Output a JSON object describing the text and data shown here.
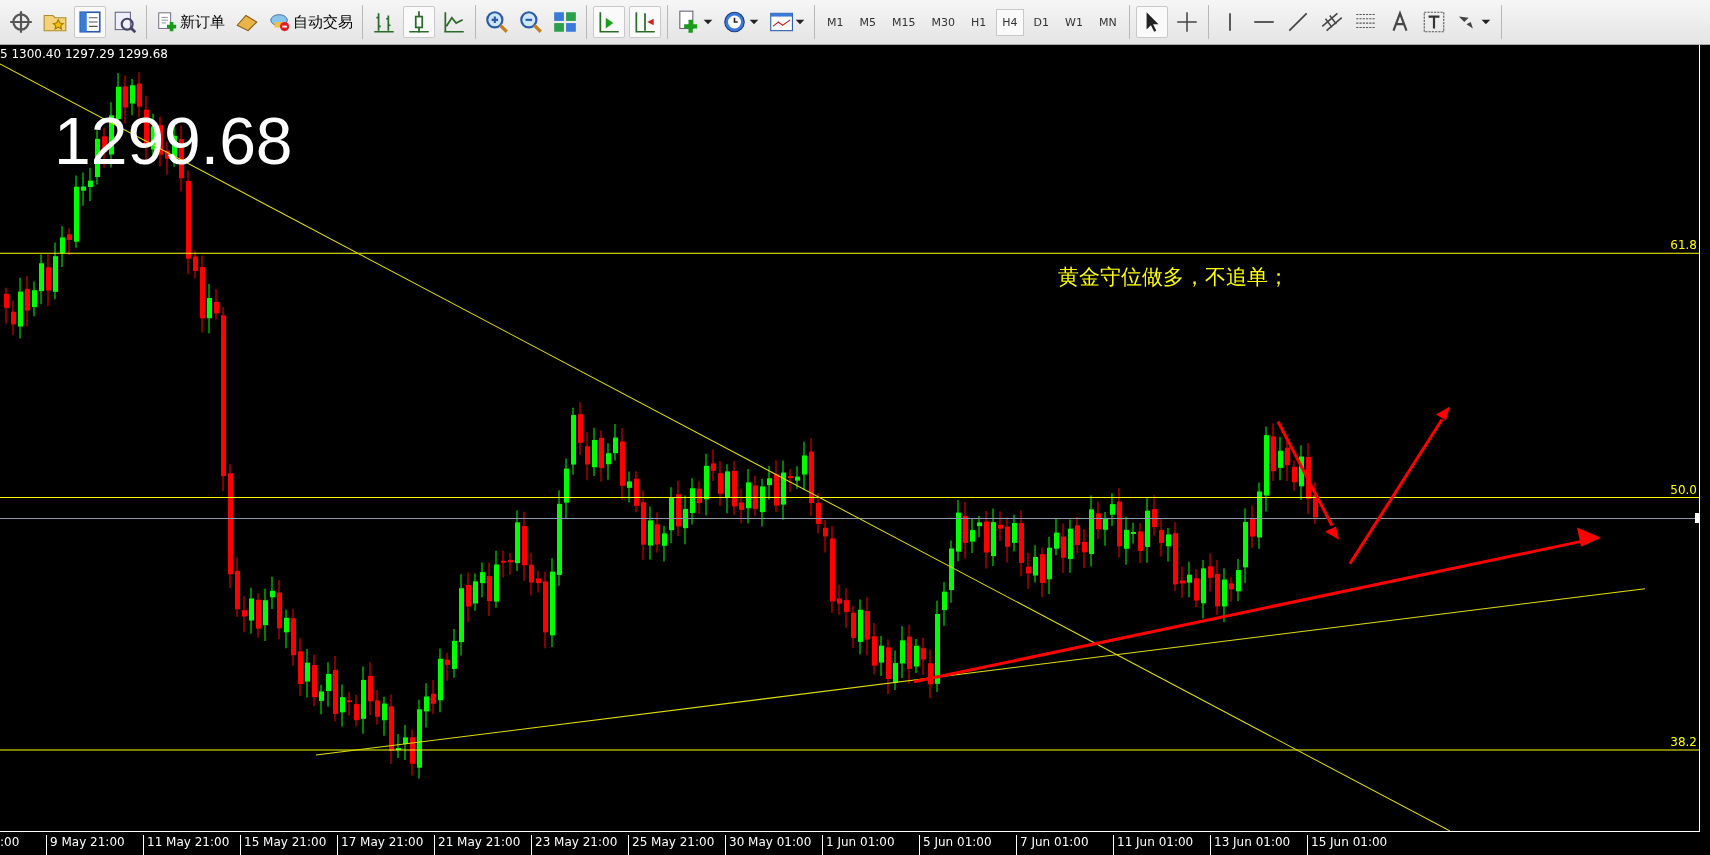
{
  "toolbar": {
    "order_button": "新订单",
    "autotrade_button": "自动交易",
    "timeframes": [
      {
        "label": "M1",
        "selected": false
      },
      {
        "label": "M5",
        "selected": false
      },
      {
        "label": "M15",
        "selected": false
      },
      {
        "label": "M30",
        "selected": false
      },
      {
        "label": "H1",
        "selected": false
      },
      {
        "label": "H4",
        "selected": true
      },
      {
        "label": "D1",
        "selected": false
      },
      {
        "label": "W1",
        "selected": false
      },
      {
        "label": "MN",
        "selected": false
      }
    ]
  },
  "chart": {
    "ohlc": "5 1300.40 1297.29 1299.68",
    "price_big": "1299.68",
    "note": "黄金守位做多，不追单；",
    "fib_levels": [
      {
        "label": "61.8"
      },
      {
        "label": "50.0"
      },
      {
        "label": "38.2"
      }
    ],
    "x_labels": [
      ":00",
      "9 May 21:00",
      "11 May 21:00",
      "15 May 21:00",
      "17 May 21:00",
      "21 May 21:00",
      "23 May 21:00",
      "25 May 21:00",
      "30 May 01:00",
      "1 Jun 01:00",
      "5 Jun 01:00",
      "7 Jun 01:00",
      "11 Jun 01:00",
      "13 Jun 01:00",
      "15 Jun 01:00"
    ]
  }
}
